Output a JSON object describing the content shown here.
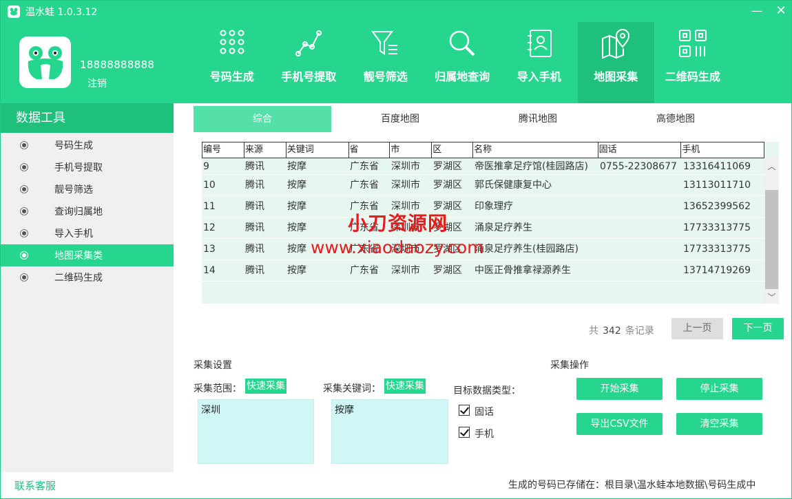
{
  "window": {
    "title": "温水蛙 1.0.3.12",
    "minimize": "—",
    "close": "✕"
  },
  "user": {
    "phone": "18888888888",
    "logout": "注销"
  },
  "nav": {
    "items": [
      {
        "label": "号码生成",
        "icon": "dots-grid-icon"
      },
      {
        "label": "手机号提取",
        "icon": "line-chart-icon"
      },
      {
        "label": "靓号筛选",
        "icon": "filter-icon"
      },
      {
        "label": "归属地查询",
        "icon": "search-icon"
      },
      {
        "label": "导入手机",
        "icon": "contact-card-icon"
      },
      {
        "label": "地图采集",
        "icon": "map-pin-icon"
      },
      {
        "label": "二维码生成",
        "icon": "qr-code-icon"
      }
    ],
    "active_index": 5
  },
  "sidebar": {
    "title": "数据工具",
    "items": [
      {
        "label": "号码生成"
      },
      {
        "label": "手机号提取"
      },
      {
        "label": "靓号筛选"
      },
      {
        "label": "查询归属地"
      },
      {
        "label": "导入手机"
      },
      {
        "label": "地图采集类"
      },
      {
        "label": "二维码生成"
      }
    ],
    "active_index": 5,
    "contact": "联系客服"
  },
  "tabs": {
    "items": [
      {
        "label": "综合"
      },
      {
        "label": "百度地图"
      },
      {
        "label": "腾讯地图"
      },
      {
        "label": "高德地图"
      }
    ],
    "active_index": 0
  },
  "table": {
    "columns": [
      "编号",
      "来源",
      "关键词",
      "省",
      "市",
      "区",
      "名称",
      "固话",
      "手机"
    ],
    "rows": [
      [
        "9",
        "腾讯",
        "按摩",
        "广东省",
        "深圳市",
        "罗湖区",
        "帝医推拿足疗馆(桂园路店)",
        "0755-22308677",
        "13316411069"
      ],
      [
        "10",
        "腾讯",
        "按摩",
        "广东省",
        "深圳市",
        "罗湖区",
        "郭氏保健康复中心",
        "",
        "13113011710"
      ],
      [
        "11",
        "腾讯",
        "按摩",
        "广东省",
        "深圳市",
        "罗湖区",
        "印象理疗",
        "",
        "13652399562"
      ],
      [
        "12",
        "腾讯",
        "按摩",
        "广东省",
        "深圳市",
        "罗湖区",
        "涌泉足疗养生",
        "",
        "17733313775"
      ],
      [
        "13",
        "腾讯",
        "按摩",
        "广东省",
        "深圳市",
        "罗湖区",
        "涌泉足疗养生(桂园路店)",
        "",
        "17733313775"
      ],
      [
        "14",
        "腾讯",
        "按摩",
        "广东省",
        "深圳市",
        "罗湖区",
        "中医正骨推拿禄源养生",
        "",
        "13714719269"
      ]
    ],
    "scroll_up": "︿",
    "scroll_down": "﹀"
  },
  "watermark": {
    "line1": "小刀资源网",
    "line2": "www.xiaodaozy.com"
  },
  "pager": {
    "prefix": "共",
    "total": "342",
    "suffix": "条记录",
    "prev": "上一页",
    "next": "下一页"
  },
  "settings": {
    "title": "采集设置",
    "range_label": "采集范围：",
    "range_quick": "快速采集",
    "range_value": "深圳",
    "keyword_label": "采集关键词：",
    "keyword_quick": "快速采集",
    "keyword_value": "按摩",
    "type_label": "目标数据类型：",
    "types": [
      {
        "label": "固话",
        "checked": true
      },
      {
        "label": "手机",
        "checked": true
      }
    ]
  },
  "operations": {
    "title": "采集操作",
    "start": "开始采集",
    "stop": "停止采集",
    "export": "导出CSV文件",
    "clear": "清空采集"
  },
  "footer": {
    "note": "生成的号码已存储在：根目录\\温水蛙本地数据\\号码生成中"
  },
  "colors": {
    "brand": "#26d58e",
    "brand_dark": "#1fbf7c",
    "tab_active": "#54e0a8",
    "table_bg": "#e7f7ef",
    "input_bg": "#cff7f5",
    "watermark": "#e41e1e"
  }
}
